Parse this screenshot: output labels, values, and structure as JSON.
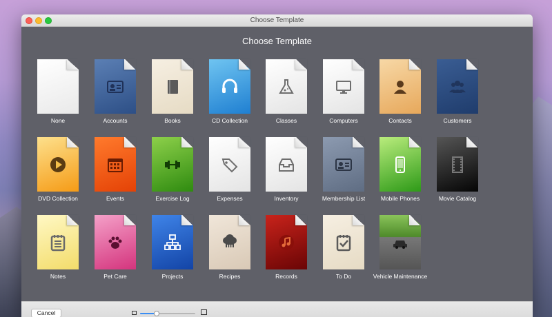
{
  "window": {
    "title": "Choose Template"
  },
  "dialog": {
    "heading": "Choose Template"
  },
  "templates": [
    {
      "key": "none",
      "label": "None",
      "style": "blank",
      "icon": "none"
    },
    {
      "key": "accounts",
      "label": "Accounts",
      "style": "blue",
      "icon": "id-card-icon"
    },
    {
      "key": "books",
      "label": "Books",
      "style": "cream",
      "icon": "book-icon"
    },
    {
      "key": "cd-collection",
      "label": "CD Collection",
      "style": "sky",
      "icon": "headphones-icon"
    },
    {
      "key": "classes",
      "label": "Classes",
      "style": "white",
      "icon": "flask-icon"
    },
    {
      "key": "computers",
      "label": "Computers",
      "style": "white",
      "icon": "monitor-icon"
    },
    {
      "key": "contacts",
      "label": "Contacts",
      "style": "peach",
      "icon": "person-icon"
    },
    {
      "key": "customers",
      "label": "Customers",
      "style": "navy",
      "icon": "people-icon"
    },
    {
      "key": "dvd-collection",
      "label": "DVD Collection",
      "style": "amber",
      "icon": "play-icon"
    },
    {
      "key": "events",
      "label": "Events",
      "style": "orange",
      "icon": "calendar-icon"
    },
    {
      "key": "exercise-log",
      "label": "Exercise Log",
      "style": "green",
      "icon": "dumbbell-icon"
    },
    {
      "key": "expenses",
      "label": "Expenses",
      "style": "white",
      "icon": "tag-icon"
    },
    {
      "key": "inventory",
      "label": "Inventory",
      "style": "white",
      "icon": "inbox-icon"
    },
    {
      "key": "membership-list",
      "label": "Membership List",
      "style": "slate",
      "icon": "id-card-icon"
    },
    {
      "key": "mobile-phones",
      "label": "Mobile Phones",
      "style": "lime",
      "icon": "phone-icon"
    },
    {
      "key": "movie-catalog",
      "label": "Movie Catalog",
      "style": "black",
      "icon": "film-icon"
    },
    {
      "key": "notes",
      "label": "Notes",
      "style": "yellow",
      "icon": "notepad-icon"
    },
    {
      "key": "pet-care",
      "label": "Pet Care",
      "style": "pink",
      "icon": "paw-icon"
    },
    {
      "key": "projects",
      "label": "Projects",
      "style": "royal",
      "icon": "org-chart-icon"
    },
    {
      "key": "recipes",
      "label": "Recipes",
      "style": "beige",
      "icon": "chef-hat-icon"
    },
    {
      "key": "records",
      "label": "Records",
      "style": "red",
      "icon": "music-note-icon"
    },
    {
      "key": "to-do",
      "label": "To Do",
      "style": "cream",
      "icon": "checklist-icon"
    },
    {
      "key": "vehicle-maintenance",
      "label": "Vehicle Maintenance",
      "style": "road",
      "icon": "car-icon"
    }
  ],
  "footer": {
    "cancel_label": "Cancel",
    "zoom_level": 0.3
  },
  "colors": {
    "dialog_background": "#5f6068",
    "label_text": "#ffffff",
    "slider_accent": "#3b8ef4"
  }
}
